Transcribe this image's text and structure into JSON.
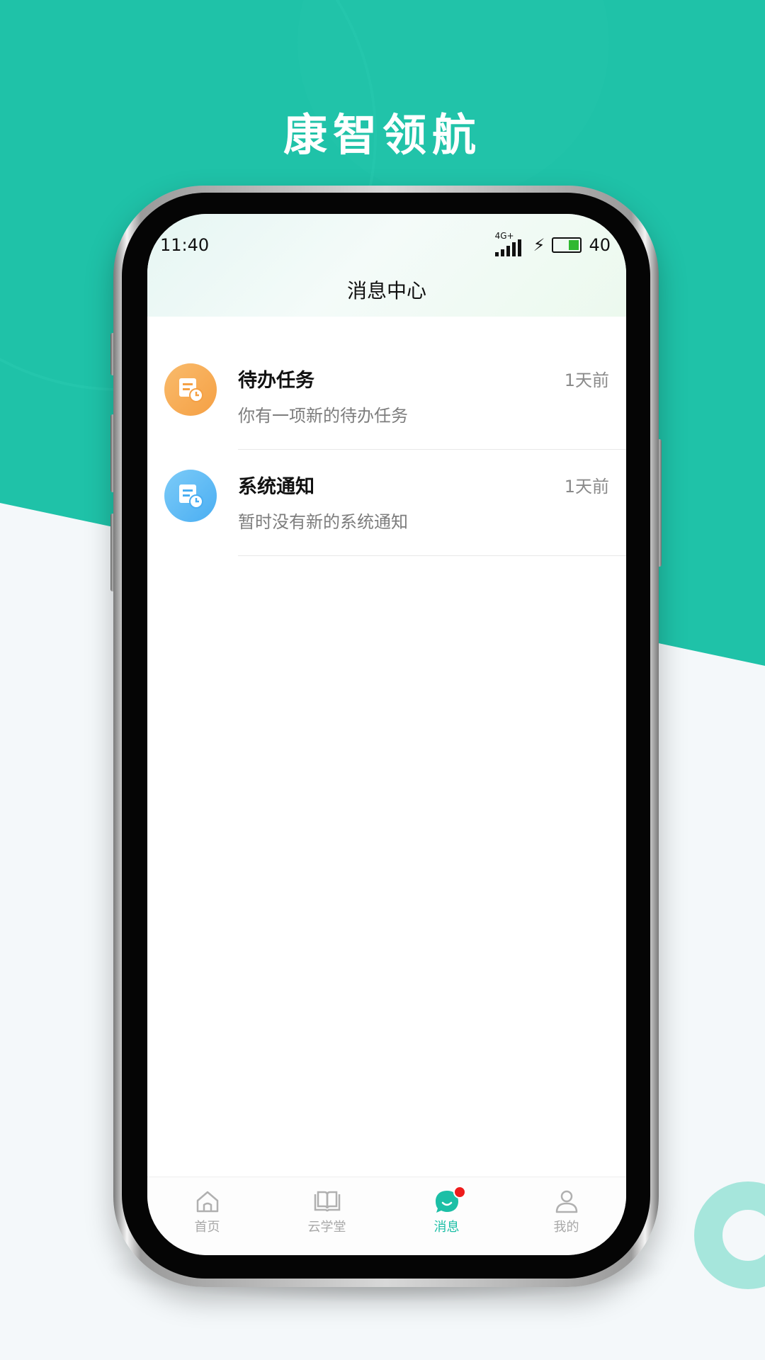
{
  "banner": {
    "title": "康智领航"
  },
  "colors": {
    "brand": "#1fc2a8",
    "accent_active": "#1cbfa6",
    "todo_icon": "#f6a44a",
    "notice_icon": "#5bb7f5",
    "badge": "#ee1c1c"
  },
  "status_bar": {
    "time": "11:40",
    "network": "4G+",
    "battery": "40"
  },
  "header": {
    "title": "消息中心"
  },
  "messages": [
    {
      "icon": "todo-document-clock-icon",
      "title": "待办任务",
      "time": "1天前",
      "subtitle": "你有一项新的待办任务"
    },
    {
      "icon": "notice-document-clock-icon",
      "title": "系统通知",
      "time": "1天前",
      "subtitle": "暂时没有新的系统通知"
    }
  ],
  "tabbar": [
    {
      "label": "首页",
      "icon": "home-icon",
      "active": false
    },
    {
      "label": "云学堂",
      "icon": "book-icon",
      "active": false
    },
    {
      "label": "消息",
      "icon": "message-icon",
      "active": true,
      "badge": true
    },
    {
      "label": "我的",
      "icon": "user-icon",
      "active": false
    }
  ]
}
